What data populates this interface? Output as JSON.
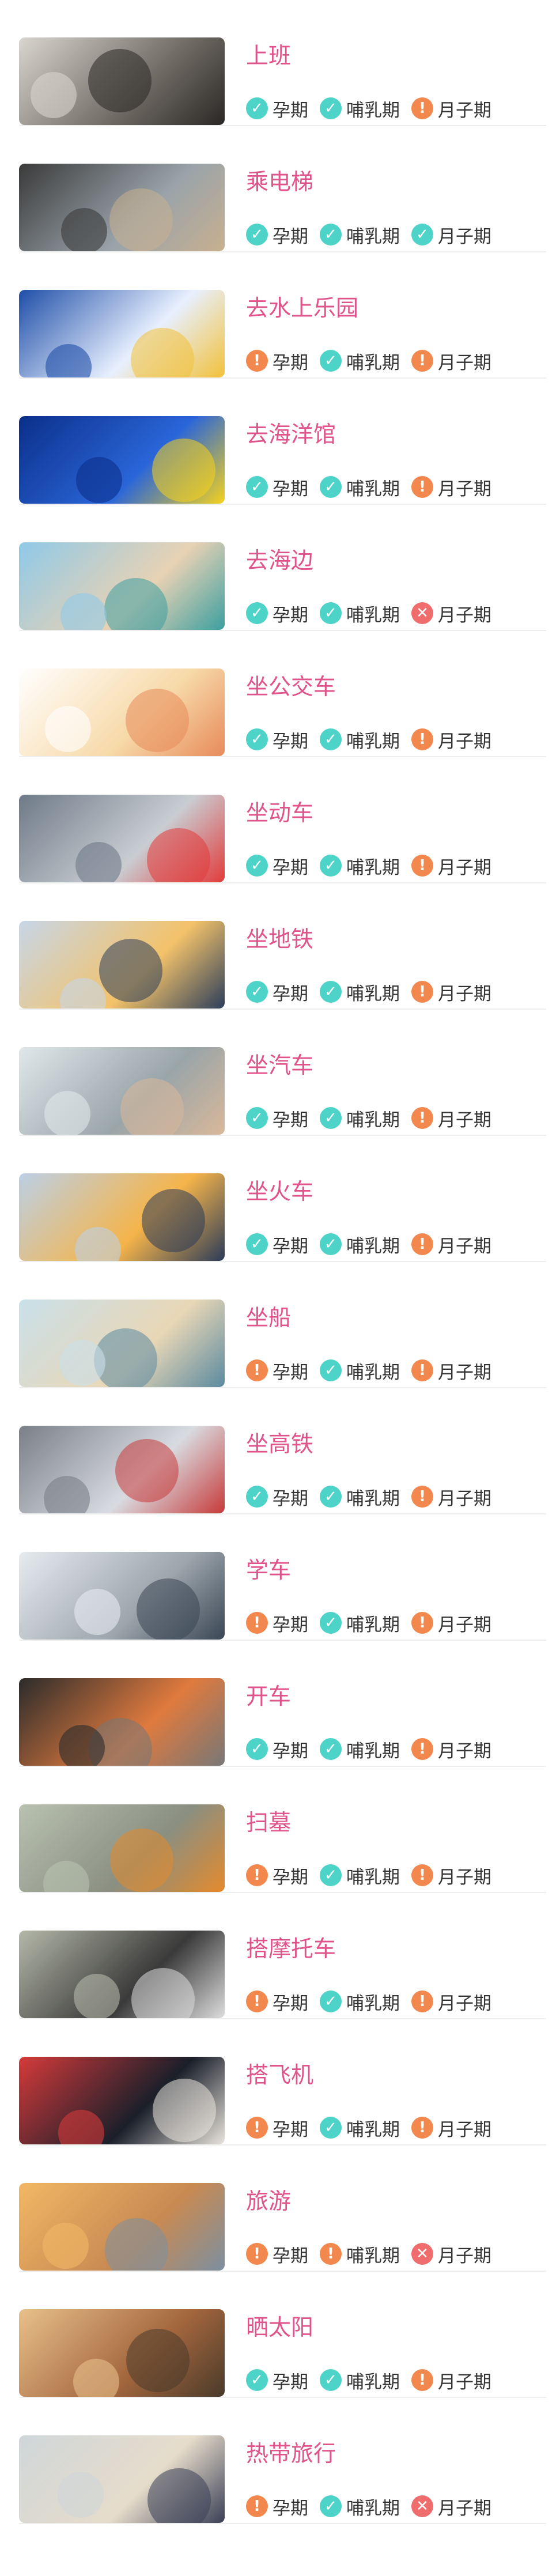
{
  "colors": {
    "title": "#e0538b",
    "ok": "#4ed3c8",
    "warn": "#f2884d",
    "no": "#ef6d6d",
    "divider": "#eeeeee"
  },
  "status_icons": {
    "ok": "check-circle-icon",
    "warn": "exclamation-circle-icon",
    "no": "cross-circle-icon"
  },
  "tag_labels": {
    "pregnancy": "孕期",
    "breastfeeding": "哺乳期",
    "postpartum": "月子期"
  },
  "items": [
    {
      "title": "上班",
      "statuses": [
        "ok",
        "ok",
        "warn"
      ],
      "image": "woman-at-desk-photo"
    },
    {
      "title": "乘电梯",
      "statuses": [
        "ok",
        "ok",
        "ok"
      ],
      "image": "escalator-people-photo"
    },
    {
      "title": "去水上乐园",
      "statuses": [
        "warn",
        "ok",
        "warn"
      ],
      "image": "water-slide-photo"
    },
    {
      "title": "去海洋馆",
      "statuses": [
        "ok",
        "ok",
        "warn"
      ],
      "image": "tropical-fish-photo"
    },
    {
      "title": "去海边",
      "statuses": [
        "ok",
        "ok",
        "no"
      ],
      "image": "pregnant-woman-beach-photo"
    },
    {
      "title": "坐公交车",
      "statuses": [
        "ok",
        "ok",
        "warn"
      ],
      "image": "bus-passengers-illustration"
    },
    {
      "title": "坐动车",
      "statuses": [
        "ok",
        "ok",
        "warn"
      ],
      "image": "high-speed-train-photo"
    },
    {
      "title": "坐地铁",
      "statuses": [
        "ok",
        "ok",
        "warn"
      ],
      "image": "yellow-train-photo"
    },
    {
      "title": "坐汽车",
      "statuses": [
        "ok",
        "ok",
        "warn"
      ],
      "image": "car-window-family-photo"
    },
    {
      "title": "坐火车",
      "statuses": [
        "ok",
        "ok",
        "warn"
      ],
      "image": "yellow-train-sunset-photo"
    },
    {
      "title": "坐船",
      "statuses": [
        "warn",
        "ok",
        "warn"
      ],
      "image": "boat-on-water-photo"
    },
    {
      "title": "坐高铁",
      "statuses": [
        "ok",
        "ok",
        "warn"
      ],
      "image": "bullet-train-photo"
    },
    {
      "title": "学车",
      "statuses": [
        "warn",
        "ok",
        "warn"
      ],
      "image": "woman-driving-photo"
    },
    {
      "title": "开车",
      "statuses": [
        "ok",
        "ok",
        "warn"
      ],
      "image": "woman-at-wheel-photo"
    },
    {
      "title": "扫墓",
      "statuses": [
        "warn",
        "ok",
        "warn"
      ],
      "image": "gravestone-flowers-photo"
    },
    {
      "title": "搭摩托车",
      "statuses": [
        "warn",
        "ok",
        "warn"
      ],
      "image": "woman-on-motorcycle-photo"
    },
    {
      "title": "搭飞机",
      "statuses": [
        "warn",
        "ok",
        "warn"
      ],
      "image": "airplane-seat-photo"
    },
    {
      "title": "旅游",
      "statuses": [
        "warn",
        "warn",
        "no"
      ],
      "image": "heart-hands-sunset-photo"
    },
    {
      "title": "晒太阳",
      "statuses": [
        "ok",
        "ok",
        "warn"
      ],
      "image": "pregnant-belly-sun-photo"
    },
    {
      "title": "热带旅行",
      "statuses": [
        "warn",
        "ok",
        "no"
      ],
      "image": "woman-camera-beach-photo"
    }
  ]
}
